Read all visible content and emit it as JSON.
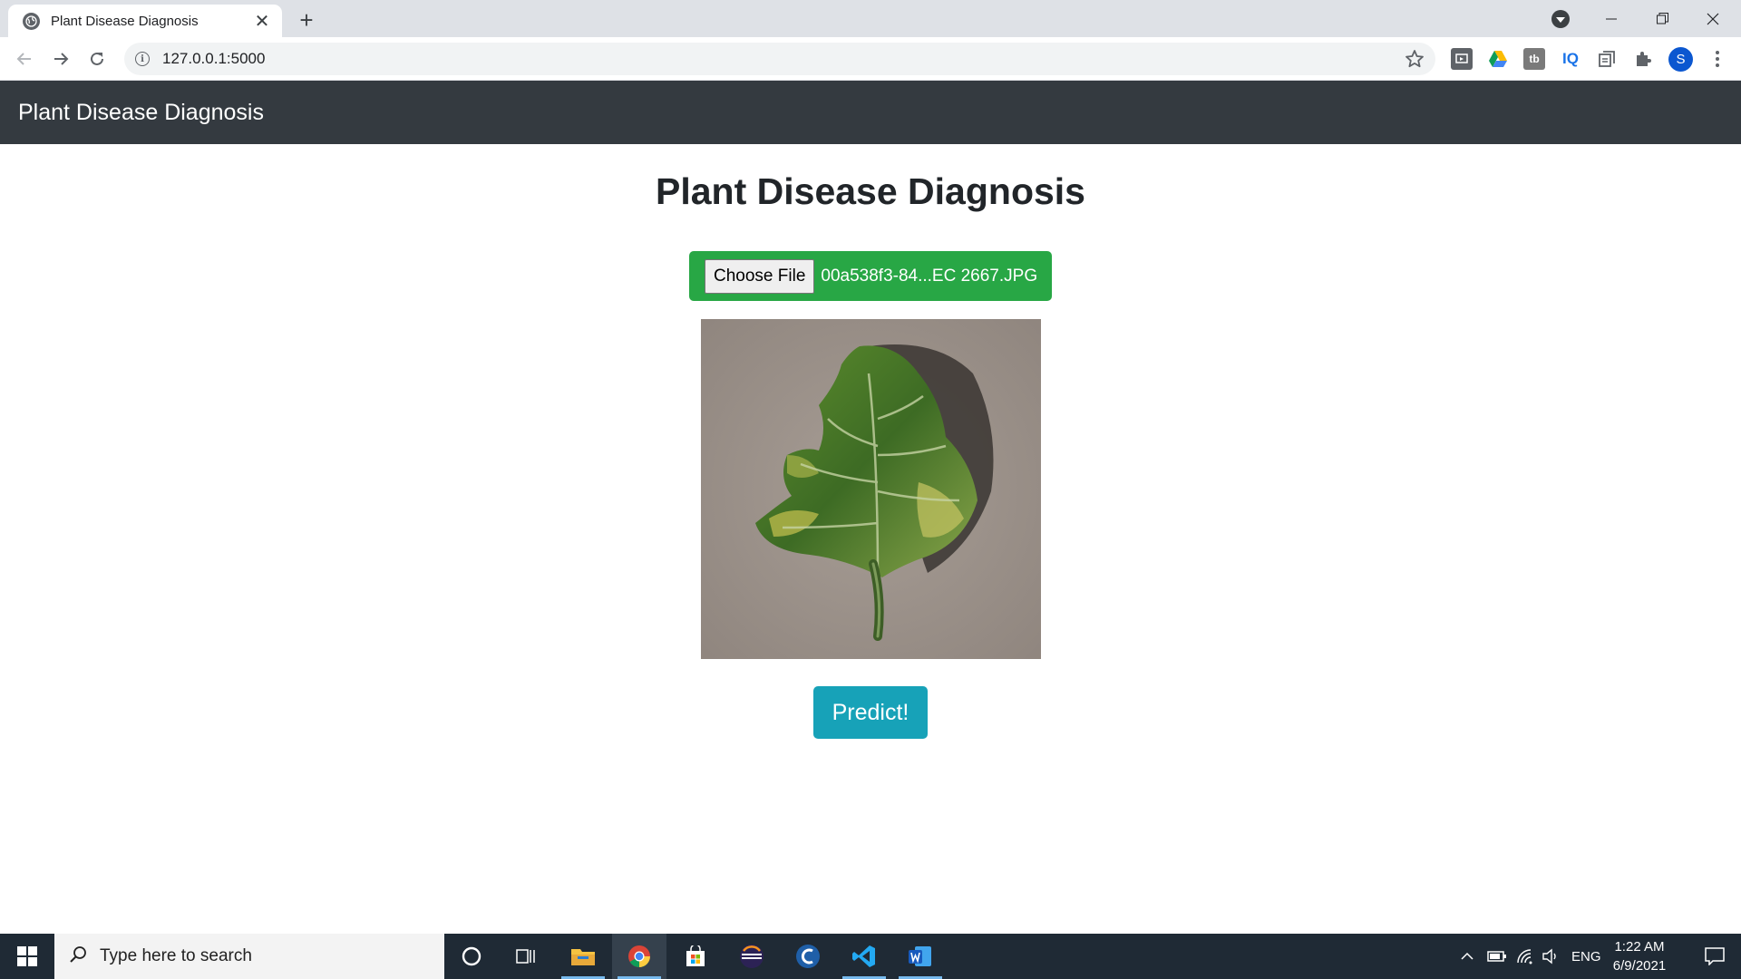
{
  "browser": {
    "tab_title": "Plant Disease Diagnosis",
    "tab_close": "✕",
    "new_tab": "+",
    "url": "127.0.0.1:5000",
    "profile_initial": "S",
    "extensions": [
      "ext-1",
      "google-drive",
      "tb",
      "IQ",
      "reader",
      "puzzle"
    ],
    "ext_tb": "tb",
    "ext_iq": "IQ"
  },
  "navbar": {
    "brand": "Plant Disease Diagnosis"
  },
  "main": {
    "heading": "Plant Disease Diagnosis",
    "choose_file_label": "Choose File",
    "file_name": "00a538f3-84...EC 2667.JPG",
    "predict_label": "Predict!"
  },
  "colors": {
    "navbar": "#343a40",
    "file_row": "#28a745",
    "predict": "#17a2b8"
  },
  "taskbar": {
    "search_placeholder": "Type here to search",
    "language": "ENG",
    "time": "1:22 AM",
    "date": "6/9/2021",
    "pinned": [
      "cortana",
      "task-view",
      "file-explorer",
      "chrome",
      "store",
      "eclipse",
      "ccleaner",
      "vscode",
      "word"
    ]
  }
}
